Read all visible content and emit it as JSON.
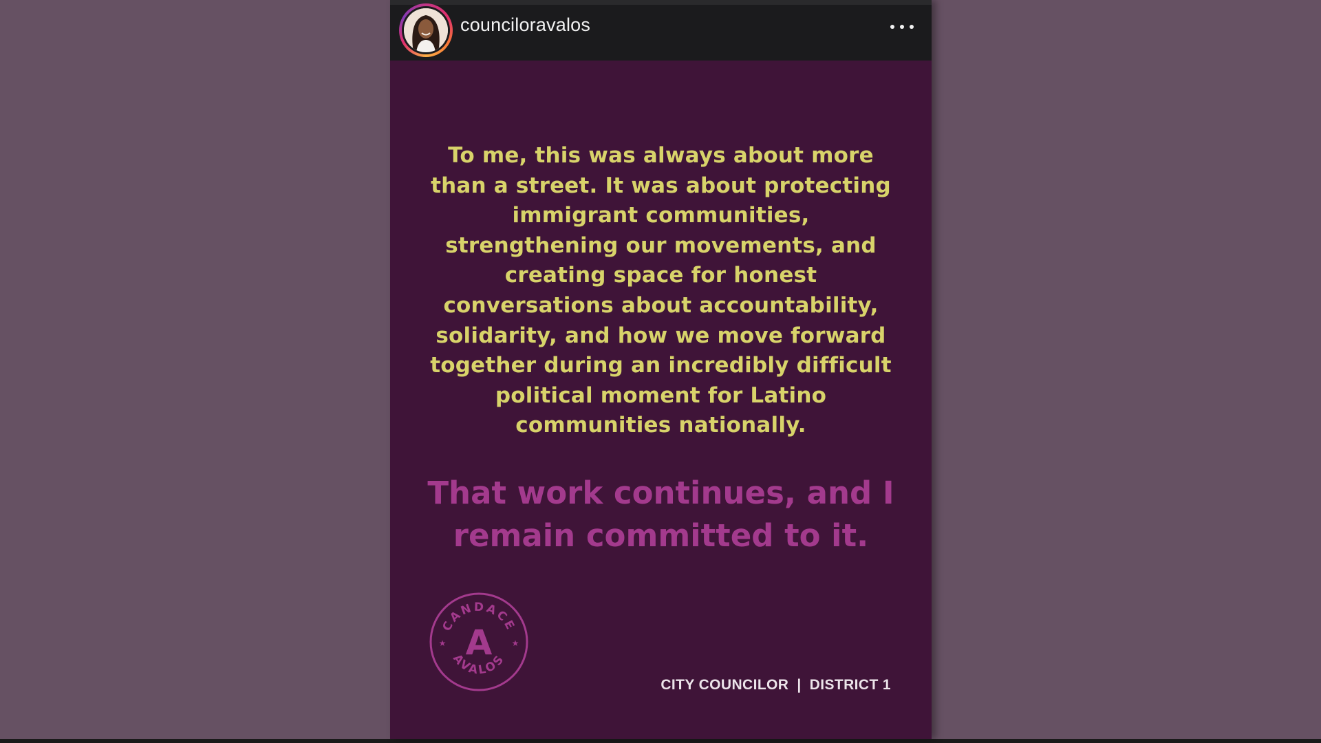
{
  "post": {
    "username": "counciloravalos",
    "more_icon": "more-horizontal-icon",
    "colors": {
      "page_background": "#665163",
      "card_background": "#3f1438",
      "header_background": "#1b1b1d",
      "body_text": "#d8d36a",
      "highlight_text": "#a33a8d",
      "footer_text": "#ece4ea"
    },
    "body_lines": [
      "To me, this was always about more",
      "than a street. It was about protecting",
      "immigrant communities,",
      "strengthening our movements, and",
      "creating space for honest",
      "conversations about accountability,",
      "solidarity, and how we move forward",
      "together during an incredibly difficult",
      "political moment for Latino",
      "communities nationally."
    ],
    "highlight_lines": [
      "That work continues, and I",
      "remain committed to it."
    ],
    "logo": {
      "letter": "A",
      "ring_text_top": "CANDACE",
      "ring_text_bottom": "AVALOS"
    },
    "footer": {
      "role": "CITY COUNCILOR",
      "separator": "|",
      "district": "DISTRICT 1"
    }
  }
}
